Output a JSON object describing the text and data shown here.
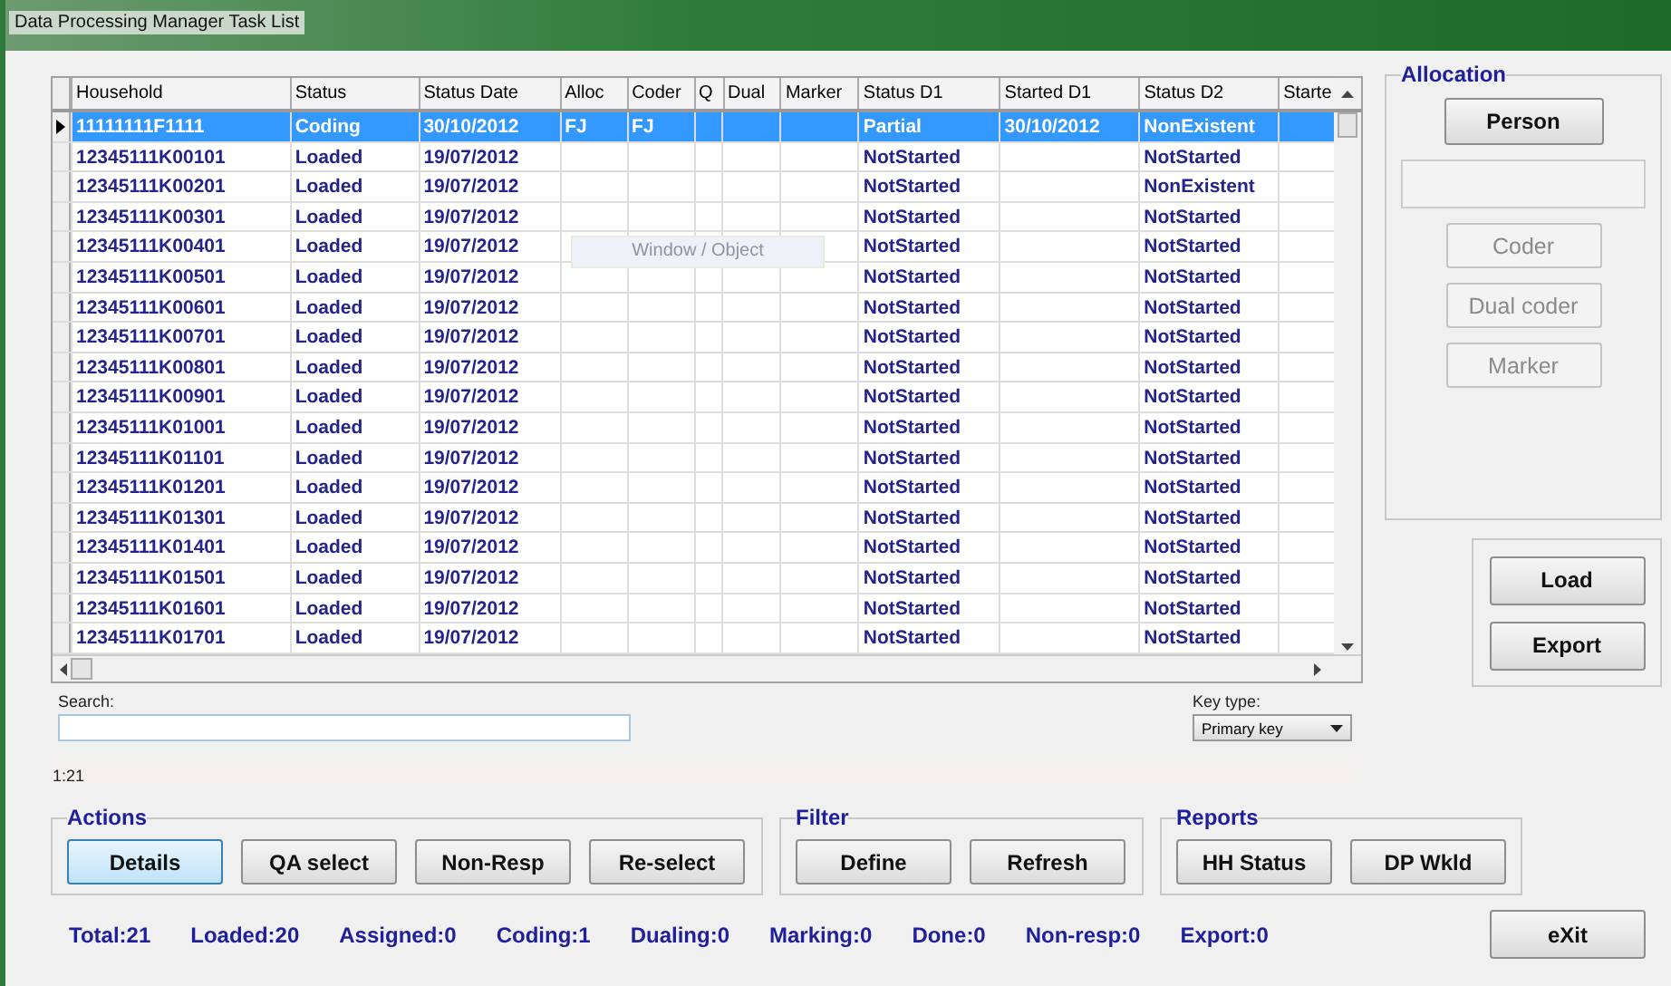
{
  "window": {
    "title": "Data Processing Manager Task List"
  },
  "table": {
    "columns": [
      "Household",
      "Status",
      "Status Date",
      "Alloc",
      "Coder",
      "Q",
      "Dual",
      "Marker",
      "Status D1",
      "Started D1",
      "Status D2",
      "Starte"
    ],
    "rows": [
      {
        "selected": true,
        "cells": [
          "11111111F1111",
          "Coding",
          "30/10/2012",
          "FJ",
          "FJ",
          "",
          "",
          "",
          "Partial",
          "30/10/2012",
          "NonExistent",
          ""
        ]
      },
      {
        "selected": false,
        "cells": [
          "12345111K00101",
          "Loaded",
          "19/07/2012",
          "",
          "",
          "",
          "",
          "",
          "NotStarted",
          "",
          "NotStarted",
          ""
        ]
      },
      {
        "selected": false,
        "cells": [
          "12345111K00201",
          "Loaded",
          "19/07/2012",
          "",
          "",
          "",
          "",
          "",
          "NotStarted",
          "",
          "NonExistent",
          ""
        ]
      },
      {
        "selected": false,
        "cells": [
          "12345111K00301",
          "Loaded",
          "19/07/2012",
          "",
          "",
          "",
          "",
          "",
          "NotStarted",
          "",
          "NotStarted",
          ""
        ]
      },
      {
        "selected": false,
        "cells": [
          "12345111K00401",
          "Loaded",
          "19/07/2012",
          "",
          "",
          "",
          "",
          "",
          "NotStarted",
          "",
          "NotStarted",
          ""
        ]
      },
      {
        "selected": false,
        "cells": [
          "12345111K00501",
          "Loaded",
          "19/07/2012",
          "",
          "",
          "",
          "",
          "",
          "NotStarted",
          "",
          "NotStarted",
          ""
        ]
      },
      {
        "selected": false,
        "cells": [
          "12345111K00601",
          "Loaded",
          "19/07/2012",
          "",
          "",
          "",
          "",
          "",
          "NotStarted",
          "",
          "NotStarted",
          ""
        ]
      },
      {
        "selected": false,
        "cells": [
          "12345111K00701",
          "Loaded",
          "19/07/2012",
          "",
          "",
          "",
          "",
          "",
          "NotStarted",
          "",
          "NotStarted",
          ""
        ]
      },
      {
        "selected": false,
        "cells": [
          "12345111K00801",
          "Loaded",
          "19/07/2012",
          "",
          "",
          "",
          "",
          "",
          "NotStarted",
          "",
          "NotStarted",
          ""
        ]
      },
      {
        "selected": false,
        "cells": [
          "12345111K00901",
          "Loaded",
          "19/07/2012",
          "",
          "",
          "",
          "",
          "",
          "NotStarted",
          "",
          "NotStarted",
          ""
        ]
      },
      {
        "selected": false,
        "cells": [
          "12345111K01001",
          "Loaded",
          "19/07/2012",
          "",
          "",
          "",
          "",
          "",
          "NotStarted",
          "",
          "NotStarted",
          ""
        ]
      },
      {
        "selected": false,
        "cells": [
          "12345111K01101",
          "Loaded",
          "19/07/2012",
          "",
          "",
          "",
          "",
          "",
          "NotStarted",
          "",
          "NotStarted",
          ""
        ]
      },
      {
        "selected": false,
        "cells": [
          "12345111K01201",
          "Loaded",
          "19/07/2012",
          "",
          "",
          "",
          "",
          "",
          "NotStarted",
          "",
          "NotStarted",
          ""
        ]
      },
      {
        "selected": false,
        "cells": [
          "12345111K01301",
          "Loaded",
          "19/07/2012",
          "",
          "",
          "",
          "",
          "",
          "NotStarted",
          "",
          "NotStarted",
          ""
        ]
      },
      {
        "selected": false,
        "cells": [
          "12345111K01401",
          "Loaded",
          "19/07/2012",
          "",
          "",
          "",
          "",
          "",
          "NotStarted",
          "",
          "NotStarted",
          ""
        ]
      },
      {
        "selected": false,
        "cells": [
          "12345111K01501",
          "Loaded",
          "19/07/2012",
          "",
          "",
          "",
          "",
          "",
          "NotStarted",
          "",
          "NotStarted",
          ""
        ]
      },
      {
        "selected": false,
        "cells": [
          "12345111K01601",
          "Loaded",
          "19/07/2012",
          "",
          "",
          "",
          "",
          "",
          "NotStarted",
          "",
          "NotStarted",
          ""
        ]
      },
      {
        "selected": false,
        "cells": [
          "12345111K01701",
          "Loaded",
          "19/07/2012",
          "",
          "",
          "",
          "",
          "",
          "NotStarted",
          "",
          "NotStarted",
          ""
        ]
      }
    ]
  },
  "ghost_tooltip": "Window / Object",
  "search": {
    "label": "Search:"
  },
  "key_type": {
    "label": "Key type:",
    "value": "Primary key"
  },
  "record_position": "1:21",
  "allocation": {
    "title": "Allocation",
    "person_button": "Person",
    "buttons": [
      {
        "label": "Coder",
        "disabled": true
      },
      {
        "label": "Dual coder",
        "disabled": true
      },
      {
        "label": "Marker",
        "disabled": true
      }
    ]
  },
  "side_buttons": [
    "Load",
    "Export"
  ],
  "groups": [
    {
      "title": "Actions",
      "buttons": [
        {
          "label": "Details",
          "focused": true
        },
        {
          "label": "QA select",
          "focused": false
        },
        {
          "label": "Non-Resp",
          "focused": false
        },
        {
          "label": "Re-select",
          "focused": false
        }
      ]
    },
    {
      "title": "Filter",
      "buttons": [
        {
          "label": "Define",
          "focused": false
        },
        {
          "label": "Refresh",
          "focused": false
        }
      ]
    },
    {
      "title": "Reports",
      "buttons": [
        {
          "label": "HH Status",
          "focused": false
        },
        {
          "label": "DP Wkld",
          "focused": false
        }
      ]
    }
  ],
  "stats": [
    "Total:21",
    "Loaded:20",
    "Assigned:0",
    "Coding:1",
    "Dualing:0",
    "Marking:0",
    "Done:0",
    "Non-resp:0",
    "Export:0"
  ],
  "exit_button": "eXit"
}
